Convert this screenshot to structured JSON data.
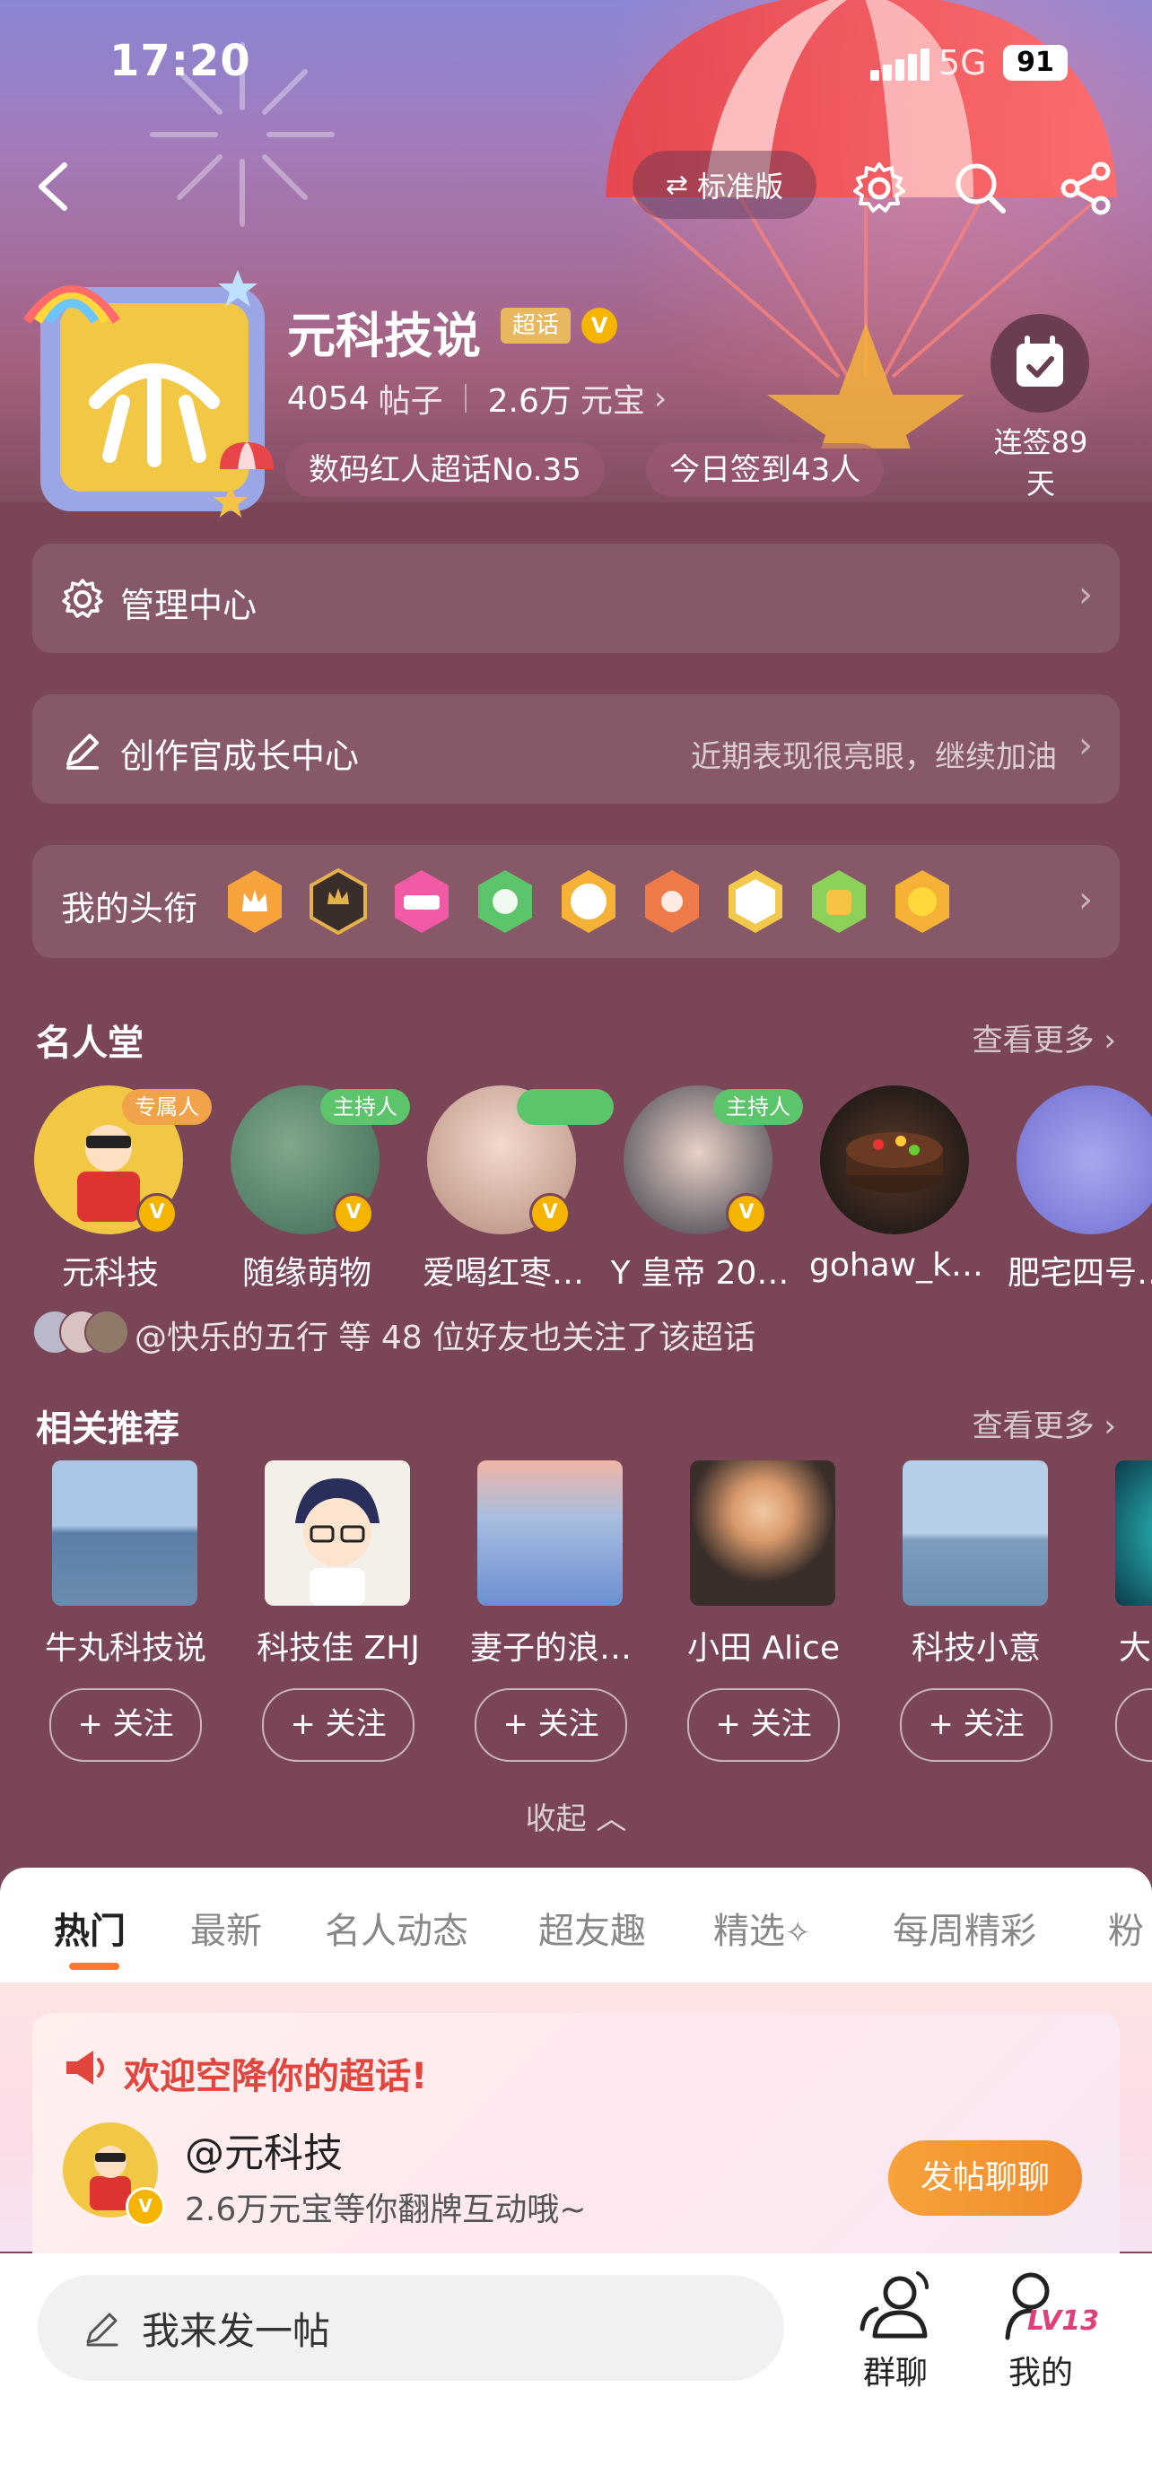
{
  "status_bar": {
    "time": "17:20",
    "network": "5G",
    "battery": "91"
  },
  "nav": {
    "version_label": "标准版"
  },
  "profile": {
    "name": "元科技说",
    "chaohua_badge": "超话",
    "v_badge": "V",
    "posts_count": "4054",
    "posts_label": "帖子",
    "coins_count": "2.6万",
    "coins_label": "元宝",
    "tags": [
      "数码红人超话No.35",
      "今日签到43人"
    ],
    "checkin_label_line1": "连签89",
    "checkin_label_line2": "天"
  },
  "cards": {
    "management": {
      "label": "管理中心"
    },
    "creator": {
      "label": "创作官成长中心",
      "hint": "近期表现很亮眼，继续加油"
    },
    "titles": {
      "label": "我的头衔"
    }
  },
  "fame": {
    "title": "名人堂",
    "more": "查看更多",
    "items": [
      {
        "name": "元科技",
        "tag": "专属人"
      },
      {
        "name": "随缘萌物",
        "tag": "主持人"
      },
      {
        "name": "爱喝红枣…",
        "tag": ""
      },
      {
        "name": "Y 皇帝 20…",
        "tag": "主持人"
      },
      {
        "name": "gohaw_k…",
        "tag": ""
      },
      {
        "name": "肥宅四号…",
        "tag": ""
      }
    ],
    "friends_text": "@快乐的五行 等 48 位好友也关注了该超话"
  },
  "recommend": {
    "title": "相关推荐",
    "more": "查看更多",
    "follow_label": "+ 关注",
    "items": [
      {
        "name": "牛丸科技说"
      },
      {
        "name": "科技佳 ZHJ"
      },
      {
        "name": "妻子的浪…"
      },
      {
        "name": "小田 Alice"
      },
      {
        "name": "科技小意"
      },
      {
        "name": "大"
      }
    ]
  },
  "collapse_label": "收起",
  "tabs": [
    "热门",
    "最新",
    "名人动态",
    "超友趣",
    "精选",
    "每周精彩",
    "粉"
  ],
  "banner": {
    "title": "欢迎空降你的超话!",
    "user": "@元科技",
    "subtitle": "2.6万元宝等你翻牌互动哦~",
    "button": "发帖聊聊"
  },
  "bottom": {
    "post_placeholder": "我来发一帖",
    "group_chat": "群聊",
    "mine": "我的",
    "level": "LV13"
  },
  "colors": {
    "accent": "#ff7a2e",
    "page_bg": "#7a4657",
    "host_tag": "#5cc46a",
    "exclusive_tag": "#f0a348"
  }
}
